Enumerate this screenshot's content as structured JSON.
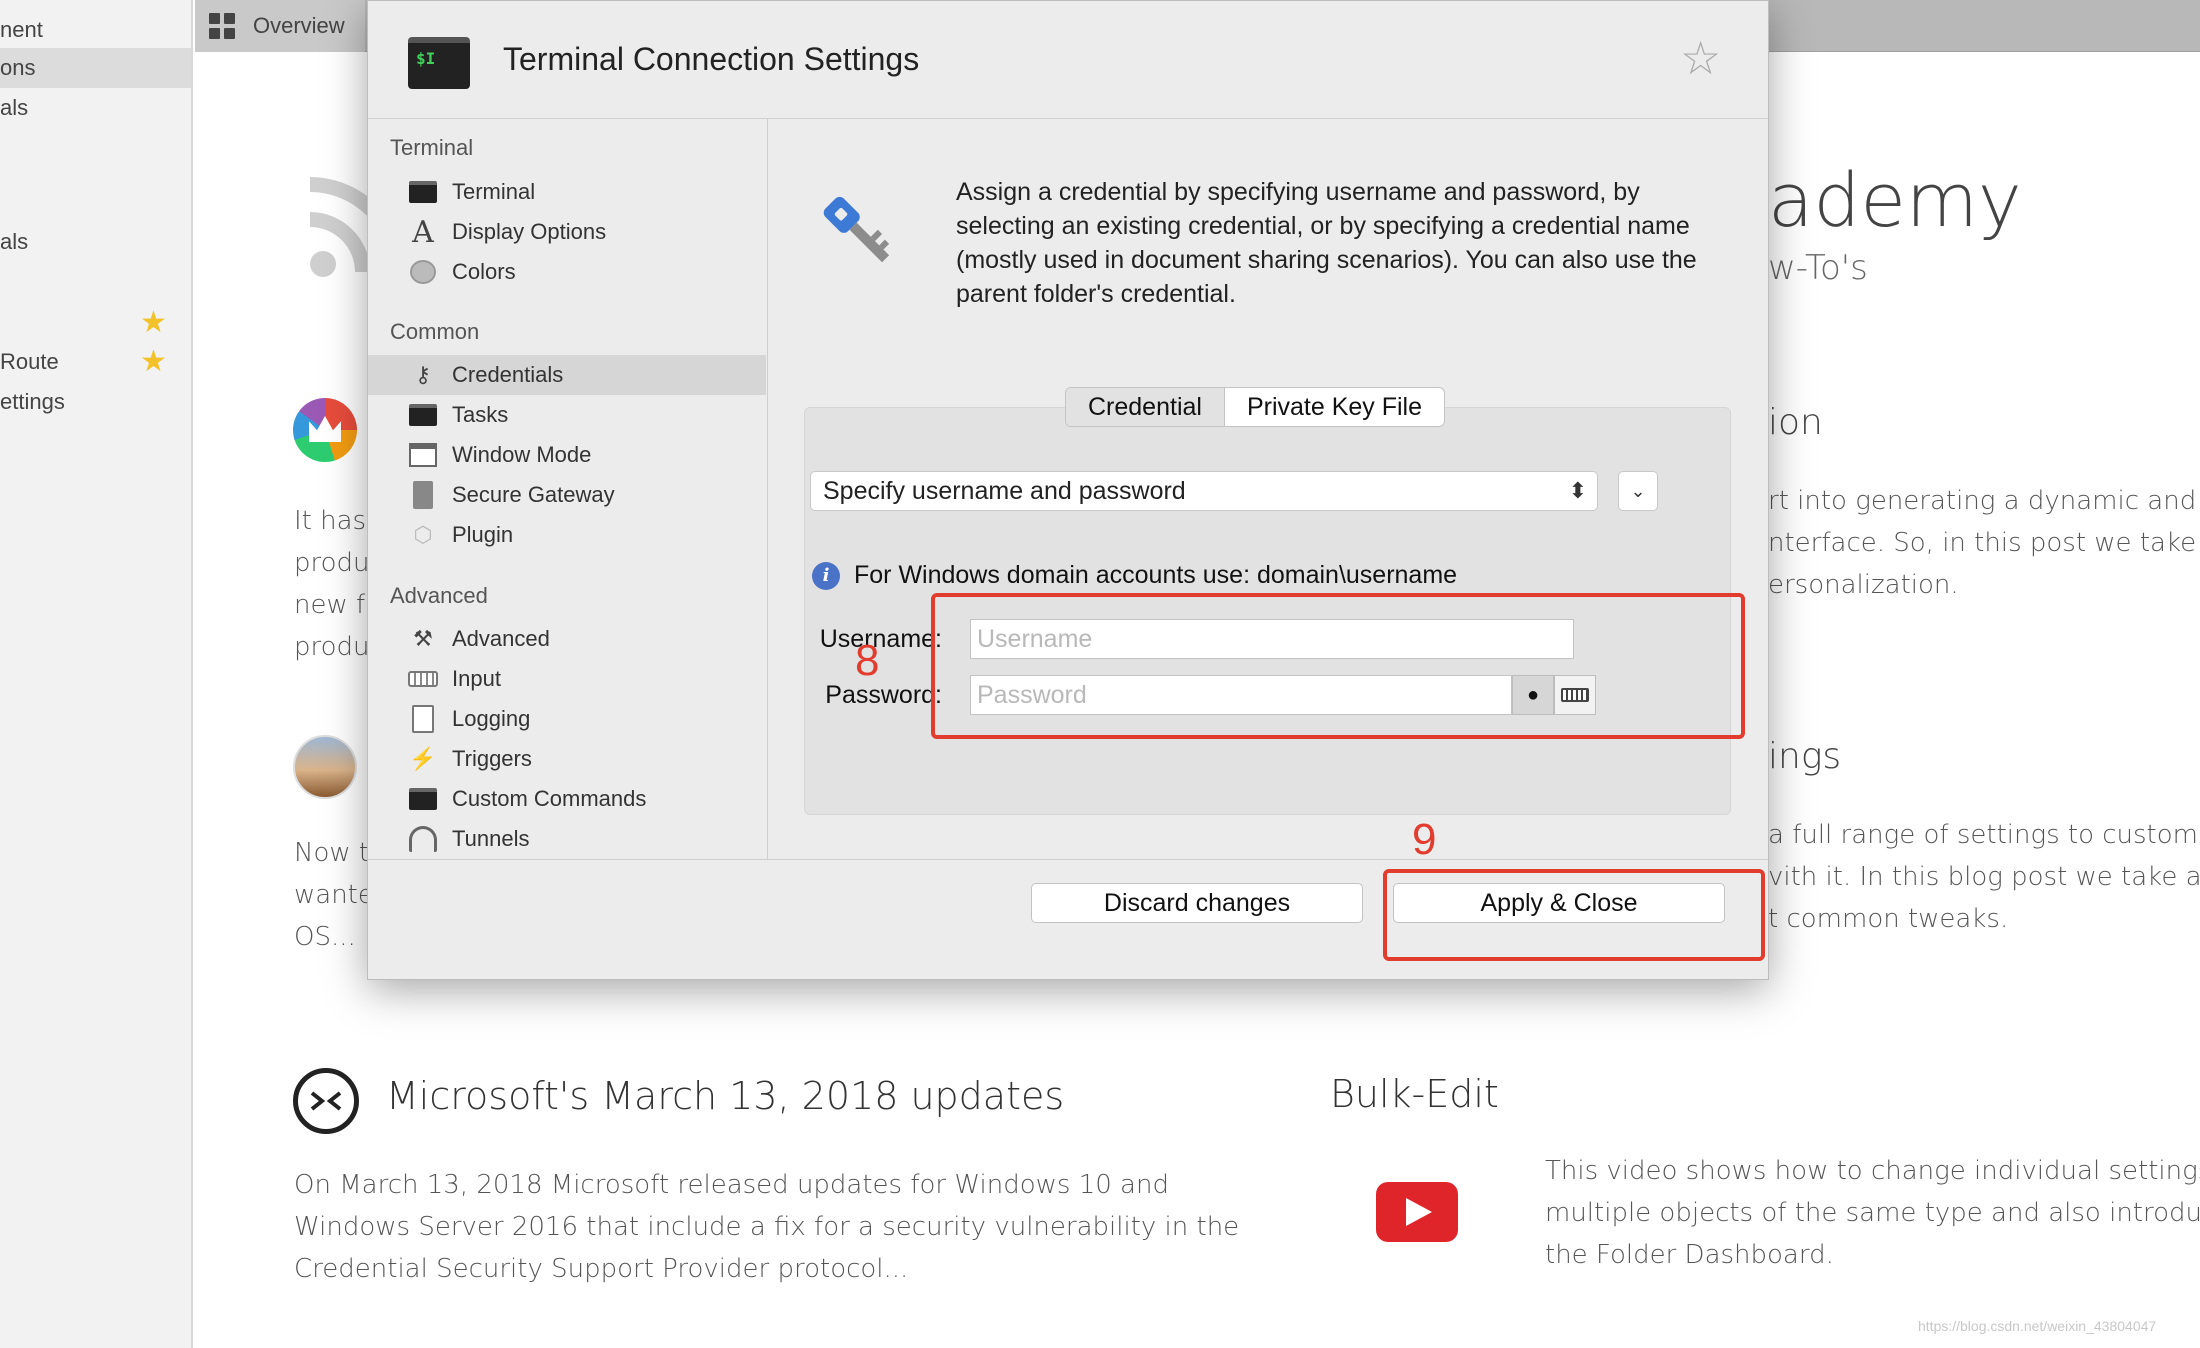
{
  "left_sidebar": {
    "items": [
      {
        "label": "nent",
        "selected": false,
        "starred": false
      },
      {
        "label": "ons",
        "selected": true,
        "starred": false
      },
      {
        "label": "als",
        "selected": false,
        "starred": false
      },
      {
        "label": "als",
        "selected": false,
        "starred": false
      },
      {
        "label": "",
        "selected": false,
        "starred": true
      },
      {
        "label": "Route",
        "selected": false,
        "starred": true
      },
      {
        "label": "ettings",
        "selected": false,
        "starred": false
      }
    ],
    "star_color": "#f3c22b"
  },
  "tab_bar": {
    "overview_label": "Overview",
    "icon": "grid-icon"
  },
  "background": {
    "cards": {
      "rss_para": [
        "It has l",
        "produ",
        "new fe",
        "produ"
      ],
      "mac_para": [
        "Now th",
        "wanted",
        "OS..."
      ]
    },
    "academy_title": "ademy",
    "academy_subtitle": "w-To's",
    "section1": {
      "heading": "ion",
      "lines": [
        "rt into generating a dynamic and",
        "nterface. So, in this post we take a",
        "ersonalization."
      ]
    },
    "section2": {
      "heading": "ings",
      "lines": [
        "a full range of settings to customize",
        "vith it. In this blog post we take a look",
        "t common tweaks."
      ]
    },
    "ms_post": {
      "title": "Microsoft's March 13, 2018 updates",
      "lines": [
        "On March 13, 2018 Microsoft released updates for Windows 10 and",
        "Windows Server 2016 that include a fix for a security vulnerability in the",
        "Credential Security Support Provider protocol..."
      ]
    },
    "bulk_edit": {
      "title": "Bulk-Edit",
      "lines": [
        "This video shows how to change individual settings on",
        "multiple objects of the same type and also introduces",
        "the Folder Dashboard."
      ]
    },
    "watermark": "https://blog.csdn.net/weixin_43804047"
  },
  "dialog": {
    "title": "Terminal Connection Settings",
    "logo_text": "$I",
    "favorite_icon": "star-outline-icon",
    "nav": {
      "sections": [
        {
          "heading": "Terminal",
          "items": [
            {
              "label": "Terminal",
              "icon": "terminal-icon"
            },
            {
              "label": "Display Options",
              "icon": "font-icon"
            },
            {
              "label": "Colors",
              "icon": "palette-icon"
            }
          ]
        },
        {
          "heading": "Common",
          "items": [
            {
              "label": "Credentials",
              "icon": "key-icon",
              "selected": true
            },
            {
              "label": "Tasks",
              "icon": "terminal-icon"
            },
            {
              "label": "Window Mode",
              "icon": "window-icon"
            },
            {
              "label": "Secure Gateway",
              "icon": "gateway-icon"
            },
            {
              "label": "Plugin",
              "icon": "plugin-icon"
            }
          ]
        },
        {
          "heading": "Advanced",
          "items": [
            {
              "label": "Advanced",
              "icon": "tools-icon"
            },
            {
              "label": "Input",
              "icon": "keyboard-icon"
            },
            {
              "label": "Logging",
              "icon": "log-icon"
            },
            {
              "label": "Triggers",
              "icon": "trigger-icon"
            },
            {
              "label": "Custom Commands",
              "icon": "terminal-icon"
            },
            {
              "label": "Tunnels",
              "icon": "tunnel-icon"
            }
          ]
        }
      ]
    },
    "description": "Assign a credential by specifying username and password, by selecting an existing credential, or by specifying a credential name (mostly used in document sharing scenarios). You can also use the parent folder's credential.",
    "tabs": [
      {
        "label": "Credential",
        "selected": true
      },
      {
        "label": "Private Key File",
        "selected": false
      }
    ],
    "credential_mode": "Specify username and password",
    "info_text": "For Windows domain accounts use: domain\\username",
    "username": {
      "label": "Username:",
      "value": "",
      "placeholder": "Username"
    },
    "password": {
      "label": "Password:",
      "value": "",
      "placeholder": "Password",
      "reveal_glyph": "●"
    },
    "discard_label": "Discard changes",
    "apply_label": "Apply & Close"
  },
  "annotations": [
    {
      "number": "8",
      "color": "#e23c2e"
    },
    {
      "number": "9",
      "color": "#e23c2e"
    }
  ]
}
